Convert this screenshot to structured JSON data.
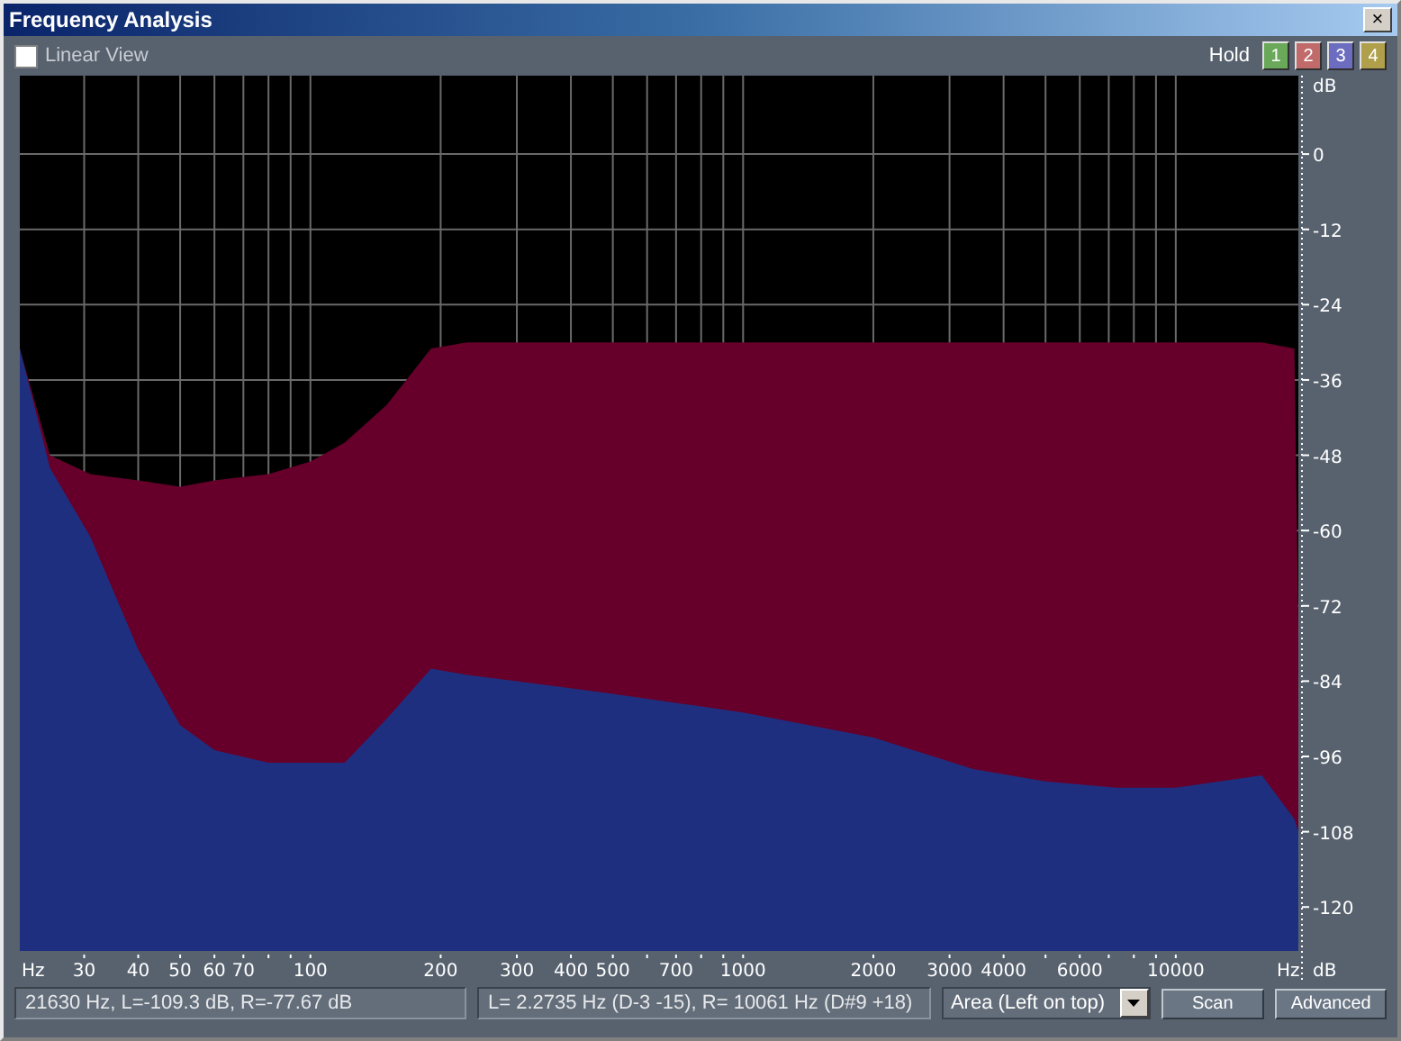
{
  "window": {
    "title": "Frequency Analysis",
    "close": "×"
  },
  "toolbar": {
    "linear_view": {
      "label": "Linear View",
      "checked": false
    },
    "hold_label": "Hold",
    "hold_buttons": [
      {
        "label": "1",
        "color": "#6aa85a"
      },
      {
        "label": "2",
        "color": "#c06a6a"
      },
      {
        "label": "3",
        "color": "#6c6cc0"
      },
      {
        "label": "4",
        "color": "#b0a04c"
      }
    ]
  },
  "plot": {
    "x_unit_left": "Hz",
    "x_unit_right": "Hz",
    "y_unit_top": "dB",
    "y_unit_bottom": "dB",
    "x_axis_labels": [
      "30",
      "40",
      "50",
      "60",
      "70",
      "100",
      "200",
      "300",
      "400",
      "500",
      "700",
      "1000",
      "2000",
      "3000",
      "4000",
      "6000",
      "10000"
    ],
    "y_axis_labels": [
      "0",
      "-12",
      "-24",
      "-36",
      "-48",
      "-60",
      "-72",
      "-84",
      "-96",
      "-108",
      "-120"
    ]
  },
  "status": {
    "cursor": "21630 Hz, L=-109.3 dB, R=-77.67 dB",
    "peaks": "L= 2.2735 Hz (D-3 -15), R=  10061 Hz (D#9 +18)",
    "display_mode": "Area (Left on top)",
    "buttons": [
      "Scan",
      "Advanced"
    ]
  }
}
